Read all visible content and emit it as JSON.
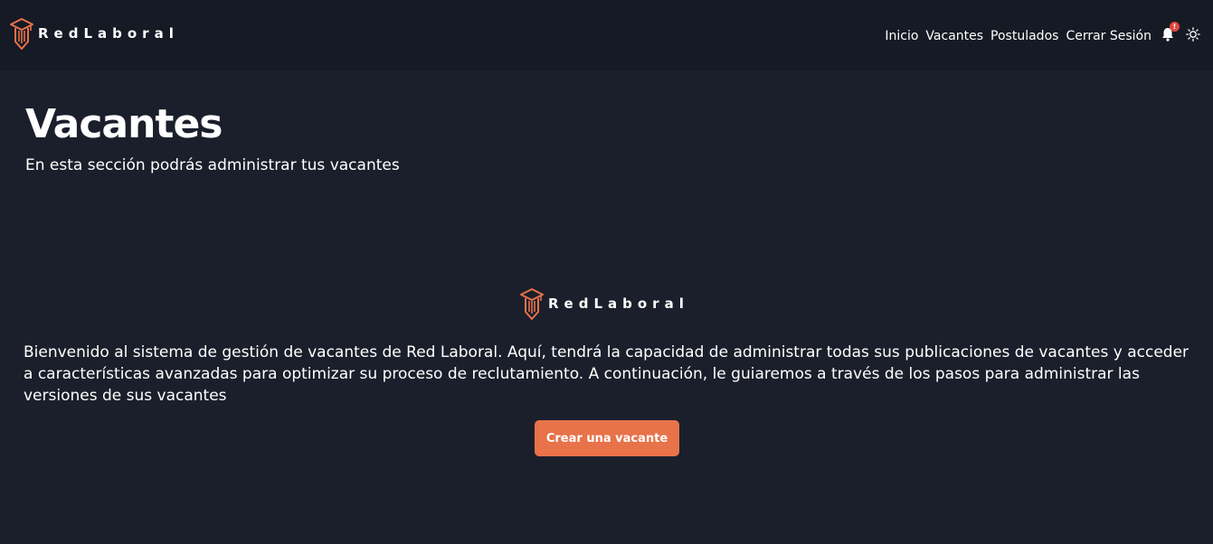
{
  "app": {
    "brand_name": "RedLaboral",
    "brand_color": "#e8724a",
    "background_color": "#1b1f2b",
    "navbar_color": "#161a24"
  },
  "navbar": {
    "links": [
      {
        "label": "Inicio"
      },
      {
        "label": "Vacantes"
      },
      {
        "label": "Postulados"
      },
      {
        "label": "Cerrar Sesión"
      }
    ],
    "notifications": {
      "icon": "bell-icon",
      "badge": "!"
    },
    "theme_toggle": {
      "icon": "sun-icon"
    }
  },
  "header": {
    "title": "Vacantes",
    "subtitle": "En esta sección podrás administrar tus vacantes"
  },
  "main": {
    "logo_text": "RedLaboral",
    "intro": "Bienvenido al sistema de gestión de vacantes de Red Laboral. Aquí, tendrá la capacidad de administrar todas sus publicaciones de vacantes y acceder a características avanzadas para optimizar su proceso de reclutamiento. A continuación, le guiaremos a través de los pasos para administrar las versiones de sus vacantes",
    "cta_label": "Crear una vacante"
  }
}
